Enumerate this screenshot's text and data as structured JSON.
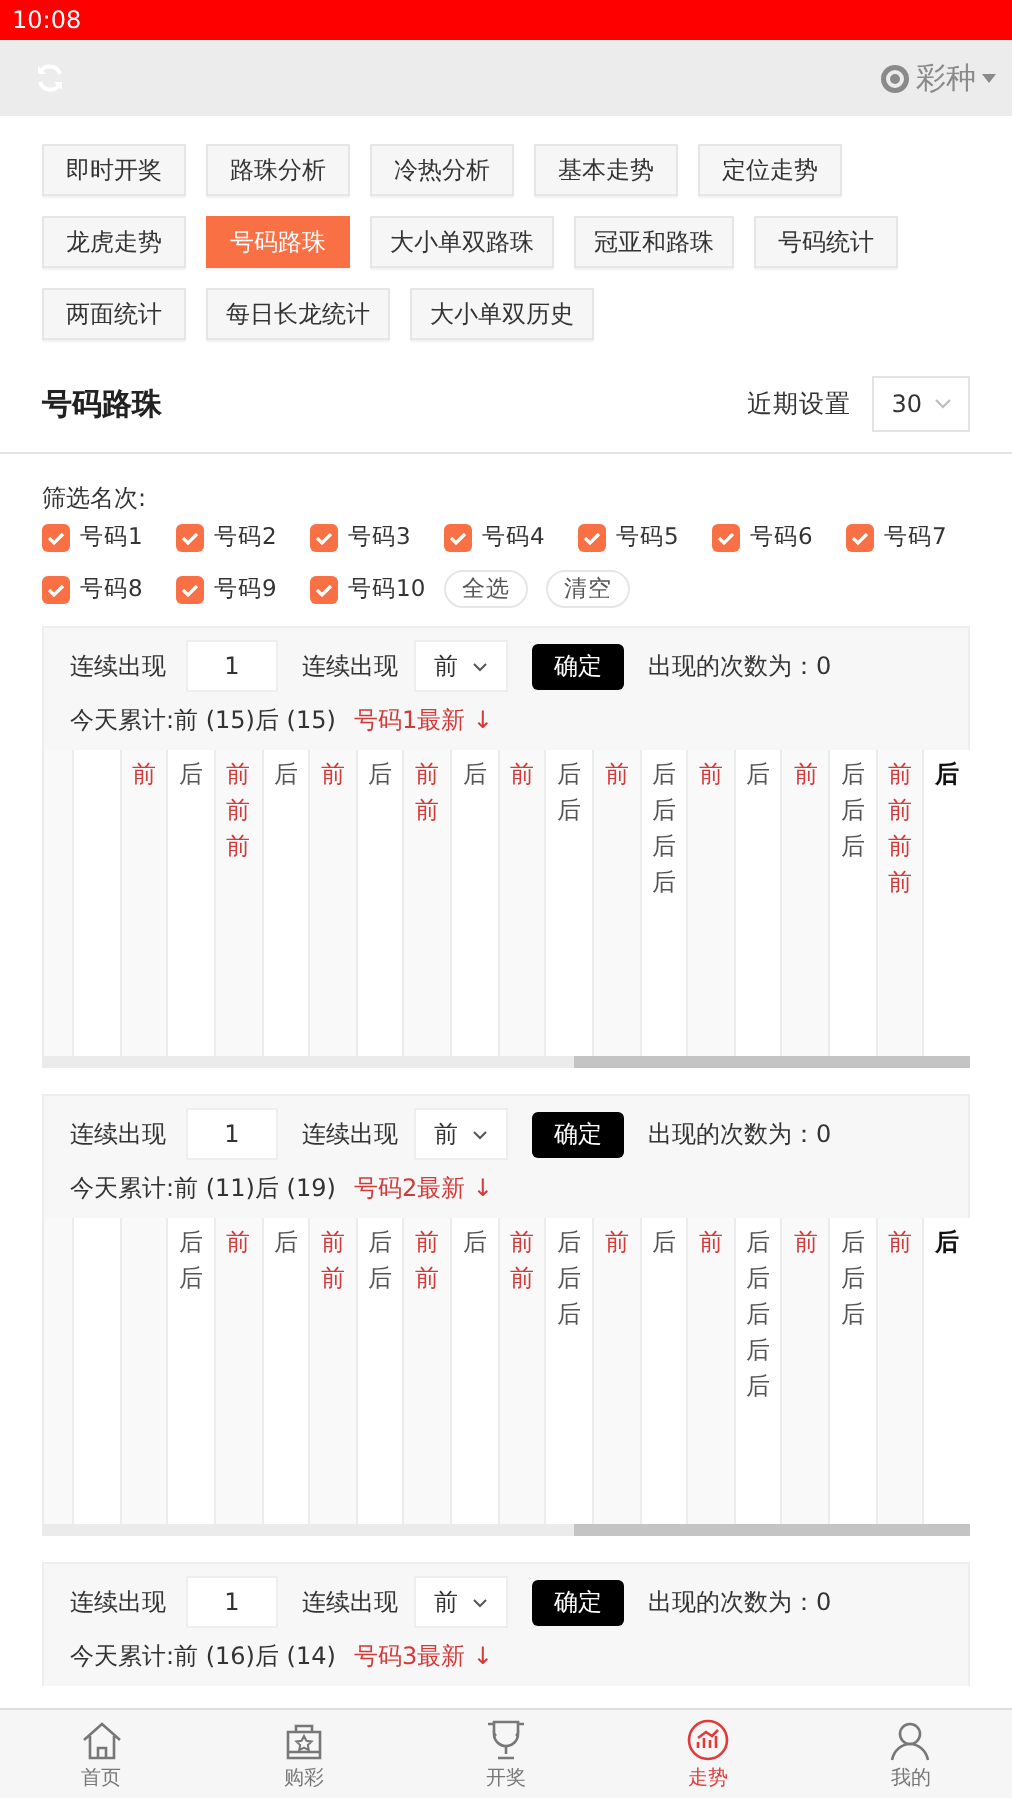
{
  "status_bar": {
    "time": "10:08"
  },
  "top_bar": {
    "lottery_menu": "彩种"
  },
  "nav_tabs": [
    {
      "label": "即时开奖",
      "selected": false
    },
    {
      "label": "路珠分析",
      "selected": false
    },
    {
      "label": "冷热分析",
      "selected": false
    },
    {
      "label": "基本走势",
      "selected": false
    },
    {
      "label": "定位走势",
      "selected": false
    },
    {
      "label": "龙虎走势",
      "selected": false
    },
    {
      "label": "号码路珠",
      "selected": true
    },
    {
      "label": "大小单双路珠",
      "selected": false
    },
    {
      "label": "冠亚和路珠",
      "selected": false
    },
    {
      "label": "号码统计",
      "selected": false
    },
    {
      "label": "两面统计",
      "selected": false
    },
    {
      "label": "每日长龙统计",
      "selected": false
    },
    {
      "label": "大小单双历史",
      "selected": false
    }
  ],
  "section": {
    "title": "号码路珠",
    "period_label": "近期设置",
    "period_value": "30"
  },
  "filter": {
    "label": "筛选名次:",
    "options": [
      {
        "label": "号码1",
        "checked": true
      },
      {
        "label": "号码2",
        "checked": true
      },
      {
        "label": "号码3",
        "checked": true
      },
      {
        "label": "号码4",
        "checked": true
      },
      {
        "label": "号码5",
        "checked": true
      },
      {
        "label": "号码6",
        "checked": true
      },
      {
        "label": "号码7",
        "checked": true
      },
      {
        "label": "号码8",
        "checked": true
      },
      {
        "label": "号码9",
        "checked": true
      },
      {
        "label": "号码10",
        "checked": true
      }
    ],
    "select_all": "全选",
    "clear": "清空"
  },
  "boards": [
    {
      "streak_label": "连续出现",
      "streak_value": "1",
      "side_label": "连续出现",
      "side_value": "前",
      "confirm": "确定",
      "count_text": "出现的次数为：0",
      "today_total": "今天累计:前 (15)后 (15)",
      "latest_text": "号码1最新 ↓",
      "columns": [
        {
          "kind": "empty"
        },
        {
          "kind": "empty"
        },
        {
          "kind": "front",
          "cells": [
            "前"
          ],
          "latest": false
        },
        {
          "kind": "back",
          "cells": [
            "后"
          ],
          "latest": false
        },
        {
          "kind": "front",
          "cells": [
            "前",
            "前",
            "前"
          ],
          "latest": false
        },
        {
          "kind": "back",
          "cells": [
            "后"
          ],
          "latest": false
        },
        {
          "kind": "front",
          "cells": [
            "前"
          ],
          "latest": false
        },
        {
          "kind": "back",
          "cells": [
            "后"
          ],
          "latest": false
        },
        {
          "kind": "front",
          "cells": [
            "前",
            "前"
          ],
          "latest": false
        },
        {
          "kind": "back",
          "cells": [
            "后"
          ],
          "latest": false
        },
        {
          "kind": "front",
          "cells": [
            "前"
          ],
          "latest": false
        },
        {
          "kind": "back",
          "cells": [
            "后",
            "后"
          ],
          "latest": false
        },
        {
          "kind": "front",
          "cells": [
            "前"
          ],
          "latest": false
        },
        {
          "kind": "back",
          "cells": [
            "后",
            "后",
            "后",
            "后"
          ],
          "latest": false
        },
        {
          "kind": "front",
          "cells": [
            "前"
          ],
          "latest": false
        },
        {
          "kind": "back",
          "cells": [
            "后"
          ],
          "latest": false
        },
        {
          "kind": "front",
          "cells": [
            "前"
          ],
          "latest": false
        },
        {
          "kind": "back",
          "cells": [
            "后",
            "后",
            "后"
          ],
          "latest": false
        },
        {
          "kind": "front",
          "cells": [
            "前",
            "前",
            "前",
            "前"
          ],
          "latest": false
        },
        {
          "kind": "back",
          "cells": [
            "后"
          ],
          "latest": true
        }
      ]
    },
    {
      "streak_label": "连续出现",
      "streak_value": "1",
      "side_label": "连续出现",
      "side_value": "前",
      "confirm": "确定",
      "count_text": "出现的次数为：0",
      "today_total": "今天累计:前 (11)后 (19)",
      "latest_text": "号码2最新 ↓",
      "columns": [
        {
          "kind": "empty"
        },
        {
          "kind": "empty"
        },
        {
          "kind": "empty"
        },
        {
          "kind": "back",
          "cells": [
            "后",
            "后"
          ],
          "latest": false
        },
        {
          "kind": "front",
          "cells": [
            "前"
          ],
          "latest": false
        },
        {
          "kind": "back",
          "cells": [
            "后"
          ],
          "latest": false
        },
        {
          "kind": "front",
          "cells": [
            "前",
            "前"
          ],
          "latest": false
        },
        {
          "kind": "back",
          "cells": [
            "后",
            "后"
          ],
          "latest": false
        },
        {
          "kind": "front",
          "cells": [
            "前",
            "前"
          ],
          "latest": false
        },
        {
          "kind": "back",
          "cells": [
            "后"
          ],
          "latest": false
        },
        {
          "kind": "front",
          "cells": [
            "前",
            "前"
          ],
          "latest": false
        },
        {
          "kind": "back",
          "cells": [
            "后",
            "后",
            "后"
          ],
          "latest": false
        },
        {
          "kind": "front",
          "cells": [
            "前"
          ],
          "latest": false
        },
        {
          "kind": "back",
          "cells": [
            "后"
          ],
          "latest": false
        },
        {
          "kind": "front",
          "cells": [
            "前"
          ],
          "latest": false
        },
        {
          "kind": "back",
          "cells": [
            "后",
            "后",
            "后",
            "后",
            "后"
          ],
          "latest": false
        },
        {
          "kind": "front",
          "cells": [
            "前"
          ],
          "latest": false
        },
        {
          "kind": "back",
          "cells": [
            "后",
            "后",
            "后"
          ],
          "latest": false
        },
        {
          "kind": "front",
          "cells": [
            "前"
          ],
          "latest": false
        },
        {
          "kind": "back",
          "cells": [
            "后"
          ],
          "latest": true
        }
      ]
    },
    {
      "streak_label": "连续出现",
      "streak_value": "1",
      "side_label": "连续出现",
      "side_value": "前",
      "confirm": "确定",
      "count_text": "出现的次数为：0",
      "today_total": "今天累计:前 (16)后 (14)",
      "latest_text": "号码3最新 ↓"
    }
  ],
  "bottom_nav": [
    {
      "label": "首页",
      "selected": false
    },
    {
      "label": "购彩",
      "selected": false
    },
    {
      "label": "开奖",
      "selected": false
    },
    {
      "label": "走势",
      "selected": true
    },
    {
      "label": "我的",
      "selected": false
    }
  ]
}
